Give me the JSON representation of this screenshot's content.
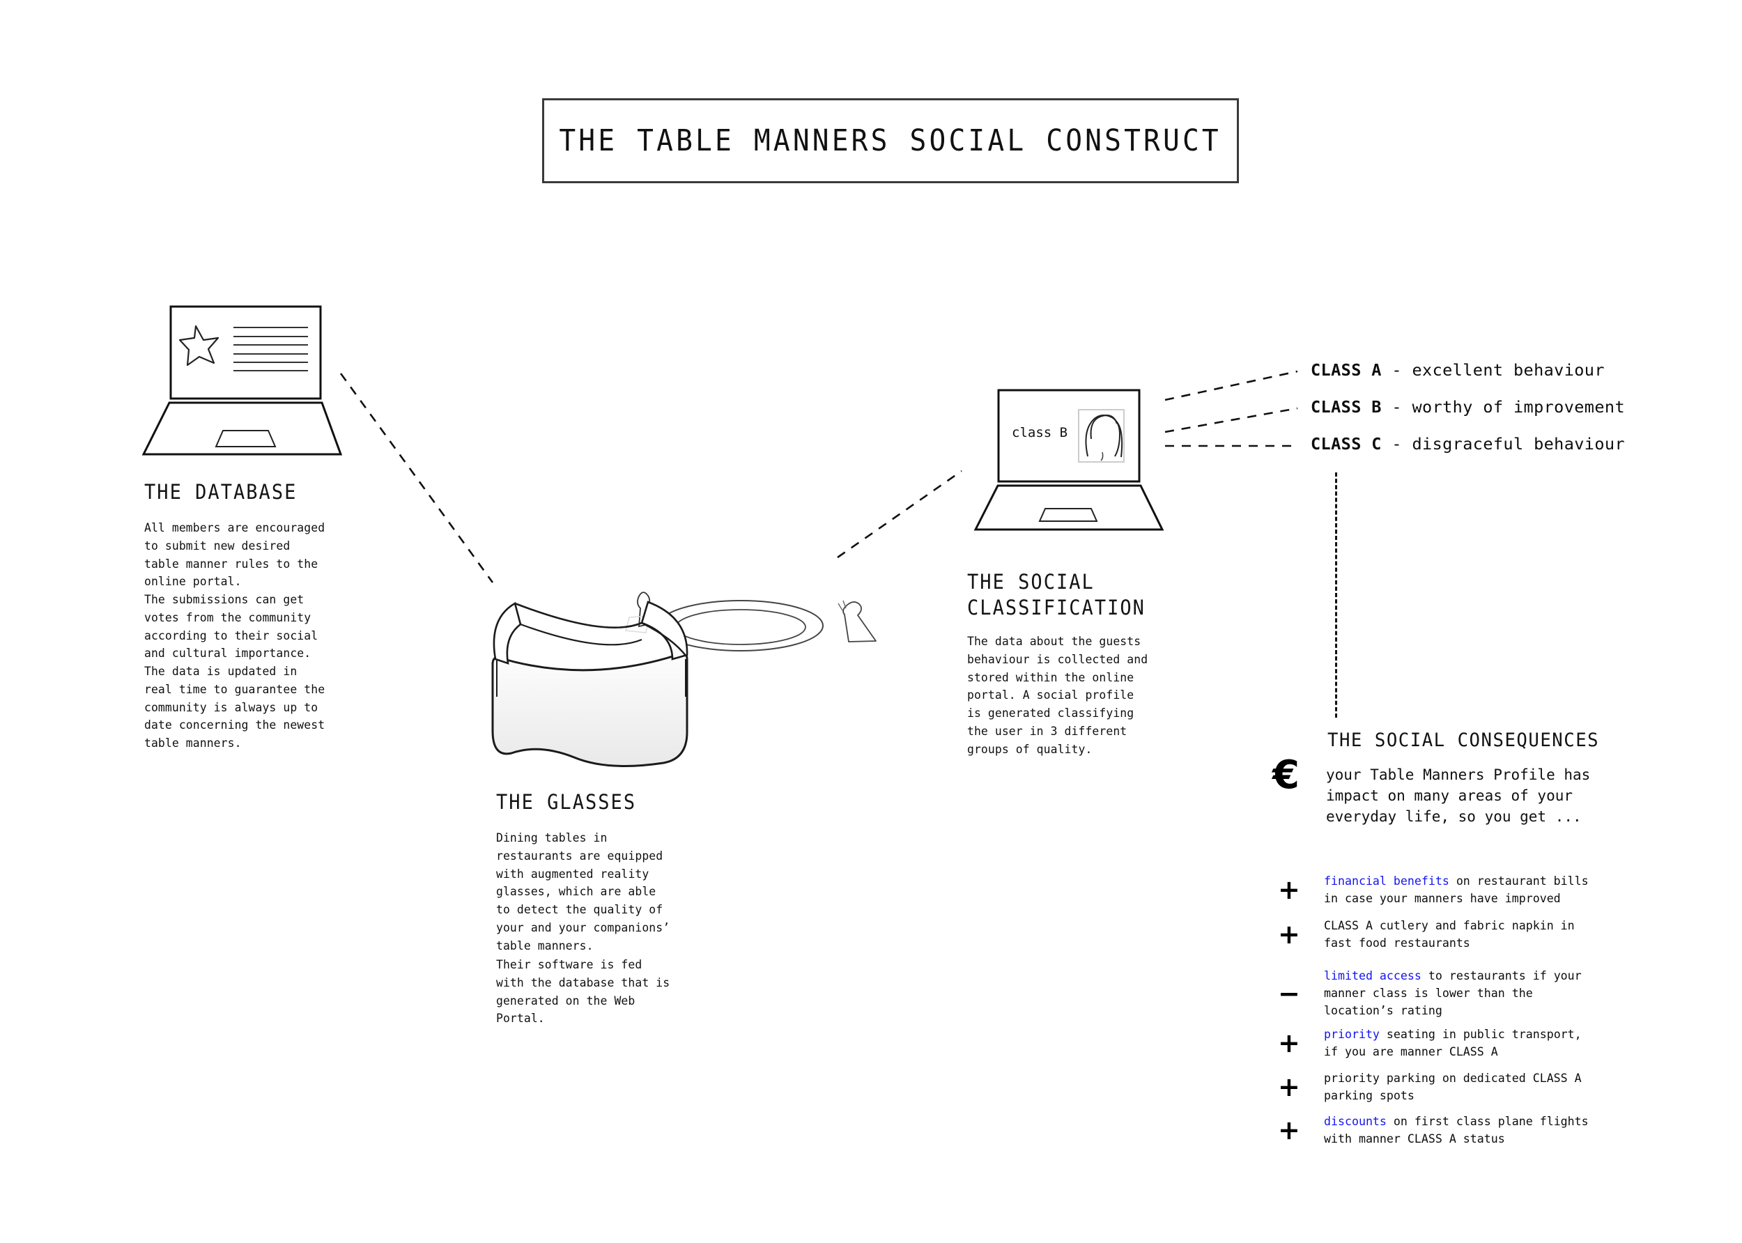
{
  "title": {
    "text": "THE TABLE MANNERS SOCIAL CONSTRUCT"
  },
  "sections": {
    "database": {
      "heading": "THE DATABASE",
      "body": "All members are encouraged\nto submit new desired\ntable manner rules to the\nonline portal.\nThe submissions can get\nvotes from the community\naccording to their social\nand cultural importance.\nThe data is updated in\nreal time to guarantee the\ncommunity is always up to\ndate concerning the newest\ntable manners."
    },
    "glasses": {
      "heading": "THE GLASSES",
      "body_1": "Dining tables in\nrestaurants are equipped\nwith augmented reality\nglasses, which are able\nto detect the quality of\nyour and your companions’\ntable manners.",
      "body_2": "Their software is fed\nwith the database that is\ngenerated on the Web\nPortal."
    },
    "classification": {
      "heading": "THE SOCIAL\nCLASSIFICATION",
      "body": "The data about the guests\nbehaviour is collected and\nstored within the online\nportal. A social profile\nis generated classifying\nthe user in 3 different\ngroups of quality.",
      "screen_label": "class B"
    },
    "consequences": {
      "heading": "THE SOCIAL CONSEQUENCES",
      "currency_symbol": "€",
      "intro": "your Table Manners Profile has\nimpact on many areas of your\neveryday life, so you get ..."
    }
  },
  "classes": [
    {
      "key": "CLASS A",
      "desc": " - excellent behaviour"
    },
    {
      "key": "CLASS B",
      "desc": " - worthy of improvement"
    },
    {
      "key": "CLASS C",
      "desc": " - disgraceful behaviour"
    }
  ],
  "consequence_items": [
    {
      "sign": "+",
      "highlight": "financial benefits",
      "rest": " on restaurant bills",
      "line2": "in case your manners have improved"
    },
    {
      "sign": "+",
      "highlight": "",
      "rest": "CLASS A cutlery and fabric napkin in",
      "line2": "fast food restaurants"
    },
    {
      "sign": "−",
      "highlight": "limited access",
      "rest": " to restaurants if your",
      "line2": "manner class is lower than the\nlocation’s rating"
    },
    {
      "sign": "+",
      "highlight": "priority",
      "rest": " seating in public transport,",
      "line2": "if you are manner CLASS A"
    },
    {
      "sign": "+",
      "highlight": "",
      "rest": "priority parking on dedicated CLASS A",
      "line2": "parking spots"
    },
    {
      "sign": "+",
      "highlight": "discounts",
      "rest": " on first class plane flights",
      "line2": "with manner CLASS A status"
    }
  ],
  "colors": {
    "highlight": "#1414f0",
    "ink": "#111111",
    "border": "#3a3a3a"
  }
}
